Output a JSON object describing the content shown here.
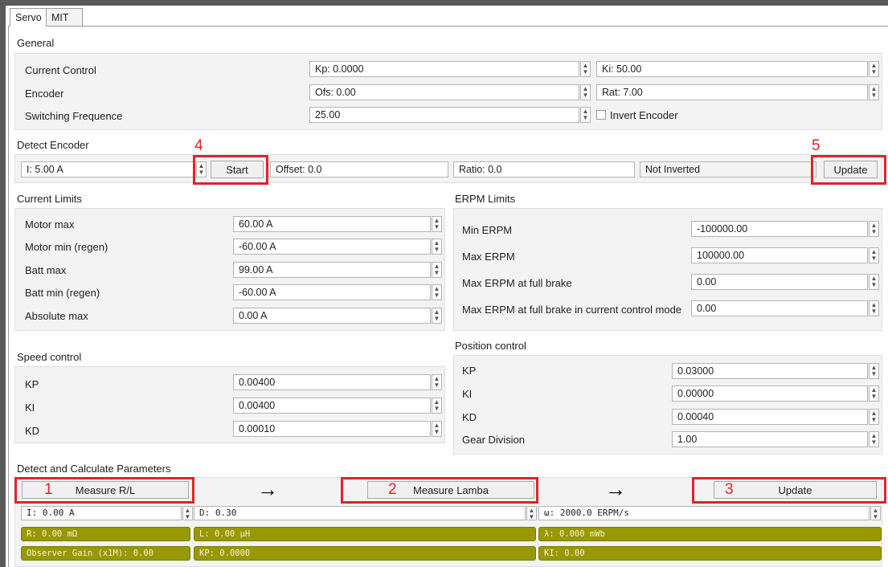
{
  "tabs": [
    {
      "label": "Servo"
    },
    {
      "label": "MIT"
    }
  ],
  "general": {
    "title": "General",
    "rows": [
      {
        "label": "Current Control",
        "left_value": "Kp: 0.0000",
        "right_value": "Ki: 50.00"
      },
      {
        "label": "Encoder",
        "left_value": "Ofs: 0.00",
        "right_value": "Rat: 7.00"
      },
      {
        "label": "Switching Frequence",
        "left_value": "25.00",
        "checkbox_label": "Invert Encoder"
      }
    ]
  },
  "detect_encoder": {
    "title": "Detect Encoder",
    "current": "I: 5.00 A",
    "start_label": "Start",
    "offset": "Offset: 0.0",
    "ratio": "Ratio: 0.0",
    "inverted": "Not Inverted",
    "update_label": "Update"
  },
  "current_limits": {
    "title": "Current Limits",
    "rows": [
      {
        "label": "Motor max",
        "value": "60.00 A"
      },
      {
        "label": "Motor min (regen)",
        "value": "-60.00 A"
      },
      {
        "label": "Batt max",
        "value": "99.00 A"
      },
      {
        "label": "Batt min (regen)",
        "value": "-60.00 A"
      },
      {
        "label": "Absolute max",
        "value": "0.00 A"
      }
    ]
  },
  "erpm_limits": {
    "title": "ERPM Limits",
    "rows": [
      {
        "label": "Min ERPM",
        "value": "-100000.00"
      },
      {
        "label": "Max ERPM",
        "value": "100000.00"
      },
      {
        "label": "Max ERPM at full brake",
        "value": "0.00"
      },
      {
        "label": "Max ERPM at full brake in current control mode",
        "value": "0.00"
      }
    ]
  },
  "speed_control": {
    "title": "Speed control",
    "rows": [
      {
        "label": "KP",
        "value": "0.00400"
      },
      {
        "label": "KI",
        "value": "0.00400"
      },
      {
        "label": "KD",
        "value": "0.00010"
      }
    ]
  },
  "position_control": {
    "title": "Position control",
    "rows": [
      {
        "label": "KP",
        "value": "0.03000"
      },
      {
        "label": "KI",
        "value": "0.00000"
      },
      {
        "label": "KD",
        "value": "0.00040"
      },
      {
        "label": "Gear Division",
        "value": "1.00"
      }
    ]
  },
  "detect_params": {
    "title": "Detect and Calculate Parameters",
    "measure_rl_label": "Measure R/L",
    "measure_lambda_label": "Measure Lamba",
    "update_label": "Update",
    "current_input": "I: 0.00 A",
    "duty_input": "D: 0.30",
    "omega_input": "ω: 2000.0 ERPM/s",
    "r_result": "R: 0.00 mΩ",
    "l_result": "L: 0.00 μH",
    "lambda_result": "λ: 0.000 mWb",
    "observer_gain": "Observer Gain (x1M): 0.00",
    "kp_result": "KP: 0.0000",
    "ki_result": "KI: 0.00"
  },
  "annotations": {
    "n1": "1",
    "n2": "2",
    "n3": "3",
    "n4": "4",
    "n5": "5",
    "arrow": "→"
  },
  "colors": {
    "highlight": "#e0232a",
    "result_fill": "#989800"
  }
}
